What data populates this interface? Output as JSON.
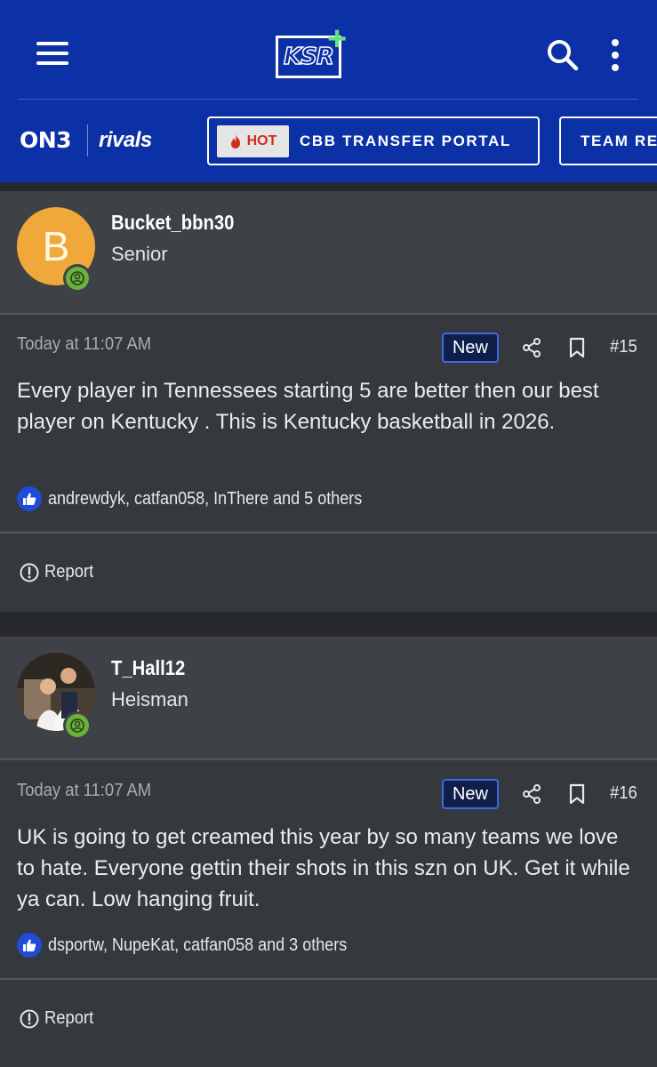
{
  "header": {
    "logo_text": "KSR",
    "logo_plus": "+",
    "brand_on3": "ON3",
    "brand_rivals": "rivals",
    "nav_pills": [
      {
        "badge": "HOT",
        "label": "CBB TRANSFER PORTAL"
      },
      {
        "label": "TEAM RE"
      }
    ],
    "colors": {
      "bar": "#0c31a6",
      "plus": "#5fe37a",
      "hot": "#d12d1d"
    }
  },
  "posts": [
    {
      "avatar_letter": "B",
      "username": "Bucket_bbn30",
      "rank": "Senior",
      "timestamp": "Today at 11:07 AM",
      "new_label": "New",
      "post_number": "#15",
      "body": "Every player in Tennessees starting 5 are better then our best player on Kentucky . This is Kentucky basketball in 2026.",
      "reactions": "andrewdyk, catfan058, InThere and 5 others",
      "report_label": "Report"
    },
    {
      "avatar_letter": "",
      "username": "T_Hall12",
      "rank": "Heisman",
      "timestamp": "Today at 11:07 AM",
      "new_label": "New",
      "post_number": "#16",
      "body": "UK is going to get creamed this year by so many teams we love to hate. Everyone gettin their shots in this szn on UK. Get it while ya can. Low hanging fruit.",
      "reactions": "dsportw, NupeKat, catfan058 and 3 others",
      "report_label": "Report"
    }
  ]
}
